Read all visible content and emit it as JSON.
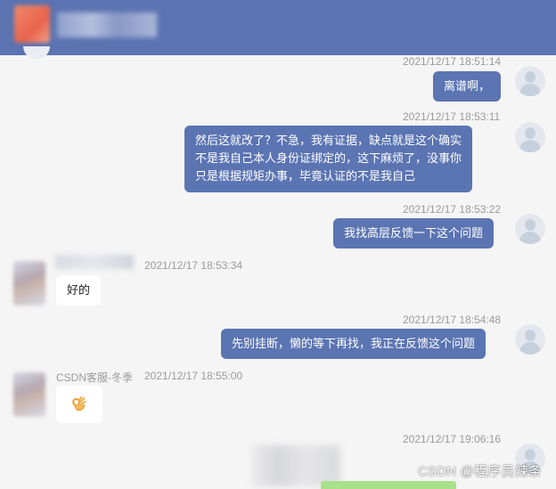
{
  "messages": [
    {
      "time": "2021/12/17 18:51:14",
      "text": "离谱啊，"
    },
    {
      "time": "2021/12/17 18:53:11",
      "lines": [
        "然后这就改了？不急，我有证据，缺点就是这个确实",
        "不是我自己本人身份证绑定的，这下麻烦了，没事你",
        "只是根据规矩办事，毕竟认证的不是我自己"
      ]
    },
    {
      "time": "2021/12/17 18:53:22",
      "text": "我找高层反馈一下这个问题"
    },
    {
      "time": "2021/12/17 18:53:34",
      "text": "好的"
    },
    {
      "time": "2021/12/17 18:54:48",
      "text": "先别挂断，懒的等下再找，我正在反馈这个问题"
    },
    {
      "time": "2021/12/17 18:55:00",
      "sender": "CSDN客服-冬季",
      "emoji": "ok-hand"
    },
    {
      "time": "2021/12/17 19:06:16"
    }
  ],
  "watermark": "CSDN @程序员辣条",
  "colors": {
    "header": "#5b73b0",
    "outgoing_bubble": "#5b74b2",
    "incoming_bubble": "#ffffff",
    "background": "#f5f5f5"
  }
}
